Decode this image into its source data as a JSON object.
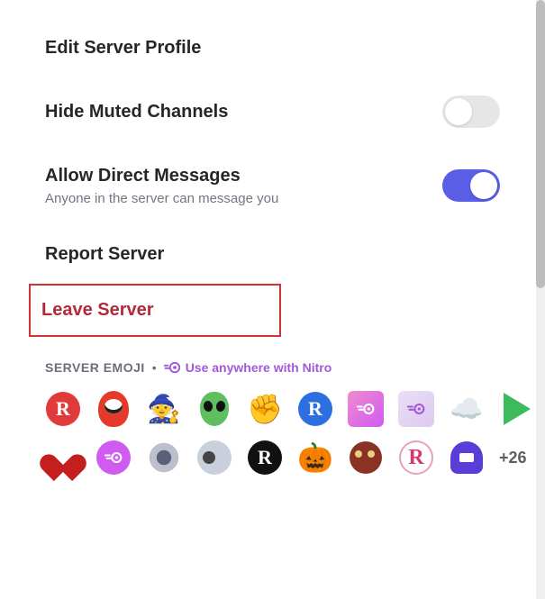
{
  "menu": {
    "editProfile": "Edit Server Profile",
    "hideMuted": "Hide Muted Channels",
    "allowDM": {
      "title": "Allow Direct Messages",
      "subtitle": "Anyone in the server can message you"
    },
    "report": "Report Server",
    "leave": "Leave Server"
  },
  "toggles": {
    "hideMuted": false,
    "allowDM": true
  },
  "emojiSection": {
    "header": "SERVER EMOJI",
    "nitroText": "Use anywhere with Nitro",
    "moreCount": "+26",
    "emojis_row1": [
      "r-red",
      "blob-red",
      "wizard",
      "alien",
      "fist",
      "r-blue",
      "nitro-pink",
      "nitro-white",
      "cloud",
      "play"
    ],
    "emojis_row2": [
      "pixel-heart",
      "nitro-circle",
      "nitro-ring",
      "astro",
      "r-black",
      "pumpkin",
      "blob-dark",
      "r-pink",
      "gem"
    ]
  },
  "colors": {
    "accentPurple": "#5a5ee6",
    "nitroPurple": "#a259d9",
    "danger": "#b02b3a",
    "highlightBorder": "#d43232"
  }
}
